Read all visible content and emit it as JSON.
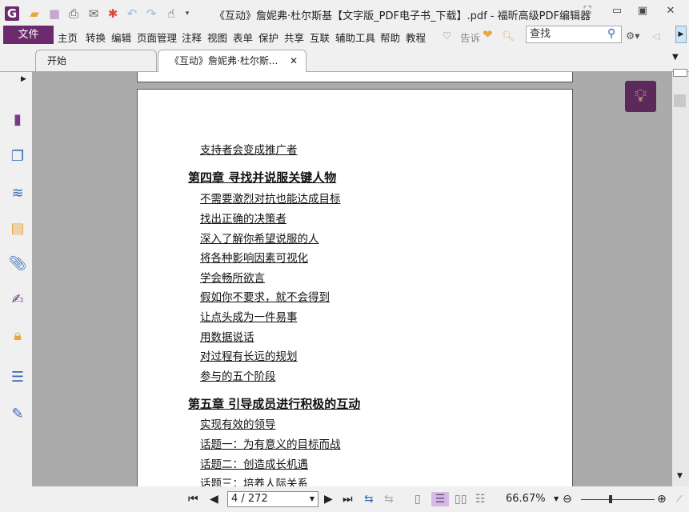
{
  "window": {
    "title": "《互动》詹妮弗·杜尔斯基【文字版_PDF电子书_下载】.pdf - 福昕高级PDF编辑器"
  },
  "menu": {
    "file": "文件",
    "items": [
      "主页",
      "转换",
      "编辑",
      "页面管理",
      "注释",
      "视图",
      "表单",
      "保护",
      "共享",
      "互联",
      "辅助工具",
      "帮助",
      "教程"
    ],
    "tell_me": "告诉"
  },
  "search": {
    "placeholder": "查找"
  },
  "tabs": [
    {
      "label": "开始"
    },
    {
      "label": "《互动》詹妮弗·杜尔斯..."
    }
  ],
  "document": {
    "lines": [
      {
        "text": "支持者会变成推广者",
        "chapter": false
      },
      {
        "text": "第四章 寻找并说服关键人物",
        "chapter": true
      },
      {
        "text": "不需要激烈对抗也能达成目标",
        "chapter": false
      },
      {
        "text": "找出正确的决策者",
        "chapter": false
      },
      {
        "text": "深入了解你希望说服的人",
        "chapter": false
      },
      {
        "text": "将各种影响因素可视化",
        "chapter": false
      },
      {
        "text": "学会畅所欲言",
        "chapter": false
      },
      {
        "text": "假如你不要求，就不会得到",
        "chapter": false
      },
      {
        "text": "让点头成为一件易事",
        "chapter": false
      },
      {
        "text": "用数据说话",
        "chapter": false
      },
      {
        "text": "对过程有长远的规划",
        "chapter": false
      },
      {
        "text": "参与的五个阶段",
        "chapter": false
      },
      {
        "text": "第五章 引导成员进行积极的互动",
        "chapter": true
      },
      {
        "text": "实现有效的领导",
        "chapter": false
      },
      {
        "text": "话题一：为有意义的目标而战",
        "chapter": false
      },
      {
        "text": "话题二：创造成长机遇",
        "chapter": false
      },
      {
        "text": "话题三：培养人际关系",
        "chapter": false
      }
    ]
  },
  "status": {
    "page": "4 / 272",
    "zoom": "66.67%",
    "zoom_slider_percent": 40
  },
  "colors": {
    "brand": "#6b2a6b"
  }
}
